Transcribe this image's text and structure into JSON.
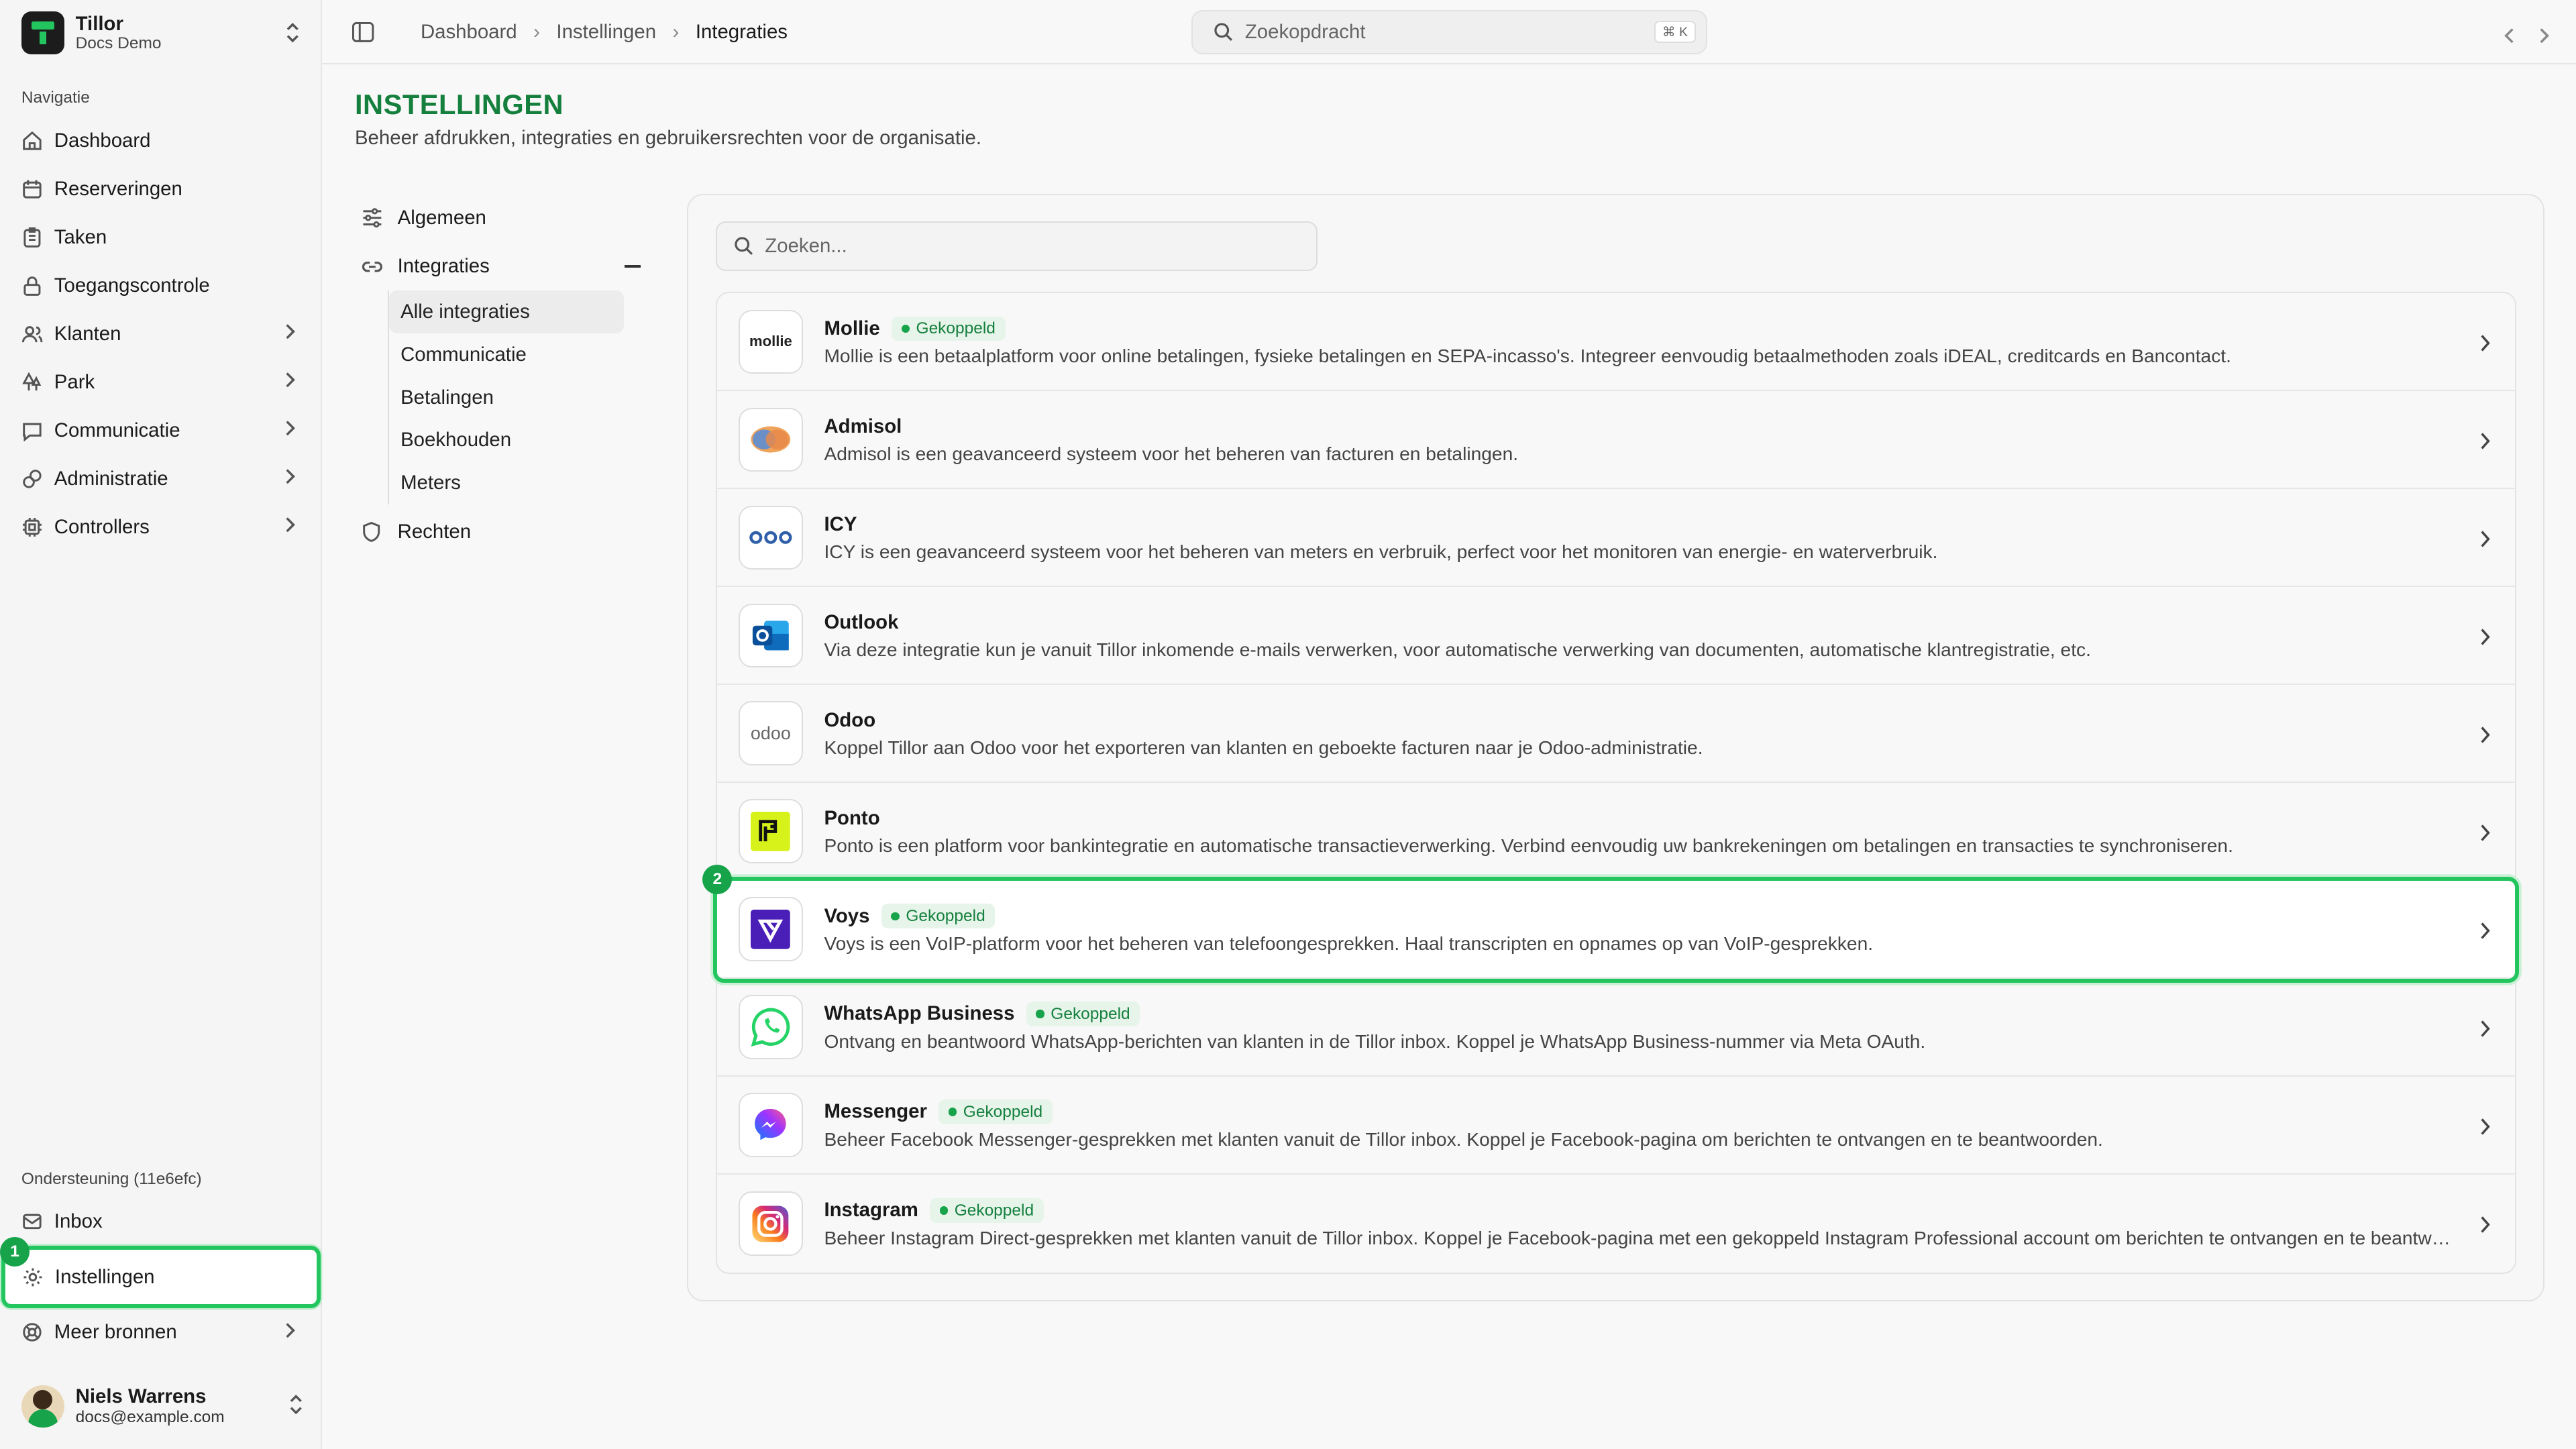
{
  "brand": {
    "name": "Tillor",
    "subtitle": "Docs Demo"
  },
  "sidebar": {
    "section_label": "Navigatie",
    "items": [
      {
        "label": "Dashboard",
        "icon": "home-icon"
      },
      {
        "label": "Reserveringen",
        "icon": "calendar-icon"
      },
      {
        "label": "Taken",
        "icon": "clipboard-icon"
      },
      {
        "label": "Toegangscontrole",
        "icon": "lock-icon"
      },
      {
        "label": "Klanten",
        "icon": "users-icon",
        "has_submenu": true
      },
      {
        "label": "Park",
        "icon": "trees-icon",
        "has_submenu": true
      },
      {
        "label": "Communicatie",
        "icon": "message-icon",
        "has_submenu": true
      },
      {
        "label": "Administratie",
        "icon": "coins-icon",
        "has_submenu": true
      },
      {
        "label": "Controllers",
        "icon": "chip-icon",
        "has_submenu": true
      }
    ],
    "support_label": "Ondersteuning (11e6efc)",
    "support_items": [
      {
        "label": "Inbox",
        "icon": "inbox-icon"
      },
      {
        "label": "Instellingen",
        "icon": "gear-icon",
        "active": true
      },
      {
        "label": "Meer bronnen",
        "icon": "lifebuoy-icon",
        "has_submenu": true
      }
    ]
  },
  "user": {
    "name": "Niels Warrens",
    "email": "docs@example.com"
  },
  "breadcrumb": [
    "Dashboard",
    "Instellingen",
    "Integraties"
  ],
  "search": {
    "placeholder": "Zoekopdracht",
    "shortcut": "⌘ K"
  },
  "page": {
    "title": "INSTELLINGEN",
    "subtitle": "Beheer afdrukken, integraties en gebruikersrechten voor de organisatie."
  },
  "settings_nav": {
    "general": "Algemeen",
    "integrations": "Integraties",
    "integration_children": [
      "Alle integraties",
      "Communicatie",
      "Betalingen",
      "Boekhouden",
      "Meters"
    ],
    "rights": "Rechten"
  },
  "integrations": {
    "search_placeholder": "Zoeken...",
    "connected_label": "Gekoppeld",
    "items": [
      {
        "name": "Mollie",
        "logo_text": "mollie",
        "connected": true,
        "description": "Mollie is een betaalplatform voor online betalingen, fysieke betalingen en SEPA-incasso's. Integreer eenvoudig betaalmethoden zoals iDEAL, creditcards en Bancontact."
      },
      {
        "name": "Admisol",
        "connected": false,
        "description": "Admisol is een geavanceerd systeem voor het beheren van facturen en betalingen."
      },
      {
        "name": "ICY",
        "connected": false,
        "description": "ICY is een geavanceerd systeem voor het beheren van meters en verbruik, perfect voor het monitoren van energie- en waterverbruik."
      },
      {
        "name": "Outlook",
        "connected": false,
        "description": "Via deze integratie kun je vanuit Tillor inkomende e-mails verwerken, voor automatische verwerking van documenten, automatische klantregistratie, etc."
      },
      {
        "name": "Odoo",
        "logo_text": "odoo",
        "connected": false,
        "description": "Koppel Tillor aan Odoo voor het exporteren van klanten en geboekte facturen naar je Odoo-administratie."
      },
      {
        "name": "Ponto",
        "connected": false,
        "description": "Ponto is een platform voor bankintegratie en automatische transactieverwerking. Verbind eenvoudig uw bankrekeningen om betalingen en transacties te synchroniseren."
      },
      {
        "name": "Voys",
        "connected": true,
        "highlight": true,
        "description": "Voys is een VoIP-platform voor het beheren van telefoongesprekken. Haal transcripten en opnames op van VoIP-gesprekken."
      },
      {
        "name": "WhatsApp Business",
        "connected": true,
        "description": "Ontvang en beantwoord WhatsApp-berichten van klanten in de Tillor inbox. Koppel je WhatsApp Business-nummer via Meta OAuth."
      },
      {
        "name": "Messenger",
        "connected": true,
        "description": "Beheer Facebook Messenger-gesprekken met klanten vanuit de Tillor inbox. Koppel je Facebook-pagina om berichten te ontvangen en te beantwoorden."
      },
      {
        "name": "Instagram",
        "connected": true,
        "description": "Beheer Instagram Direct-gesprekken met klanten vanuit de Tillor inbox. Koppel je Facebook-pagina met een gekoppeld Instagram Professional account om berichten te ontvangen en te beantwoorden."
      }
    ]
  },
  "step_markers": [
    "1",
    "2"
  ],
  "colors": {
    "accent": "#22c55e",
    "title": "#15803d"
  }
}
